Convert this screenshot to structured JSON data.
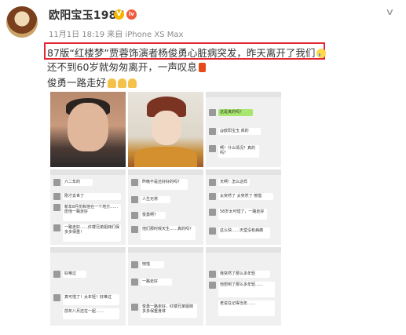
{
  "post": {
    "username": "欧阳宝玉1987",
    "verified_badge": "V",
    "level_badge": "lv",
    "meta": "11月1日 18:19 来自 iPhone XS Max",
    "line1": "87版“红楼梦”贾蓉饰演者杨俊勇心脏病突发，昨天离开了我们",
    "line2": "还不到60岁就匆匆离开，一声叹息",
    "line3": "俊勇一路走好",
    "menu_icon": "chevron-down-icon"
  },
  "grid": {
    "images": [
      {
        "kind": "portrait"
      },
      {
        "kind": "costume-portrait"
      },
      {
        "kind": "chat",
        "messages": [
          "这是真的吗？",
          "@欧阳宝玉 真的",
          "啊！什么情况？真的吗？"
        ]
      },
      {
        "kind": "chat",
        "messages": [
          "六二年的",
          "刚才去世了",
          "新年8月份和他在一个地方……愿他一路走好",
          "一路走好……红楼兄弟姐妹们保多多保重！"
        ]
      },
      {
        "kind": "chat",
        "messages": [
          "昨晚不是还好好的吗？",
          "人生无常",
          "俊勇啊？",
          "他们那时候天生……真的吗？"
        ]
      },
      {
        "kind": "chat",
        "messages": [
          "天啊！怎么这样",
          "太突然了 太突然了 惋惜",
          "58岁太可惜了，一路走好",
          "这么快……天堂没有病痛"
        ]
      },
      {
        "kind": "chat",
        "messages": [
          "好难过",
          "真可惜了！太年轻！好难过",
          "前年八月还在一起……"
        ]
      },
      {
        "kind": "chat",
        "messages": [
          "惋惜",
          "一路走好",
          "俊勇一路走好，红楼兄弟姐妹多多保重身体"
        ]
      },
      {
        "kind": "chat",
        "messages": [
          "我突然了那么多年轻",
          "他想到了那么多年轻……",
          "老说在记得当年……"
        ]
      }
    ]
  }
}
